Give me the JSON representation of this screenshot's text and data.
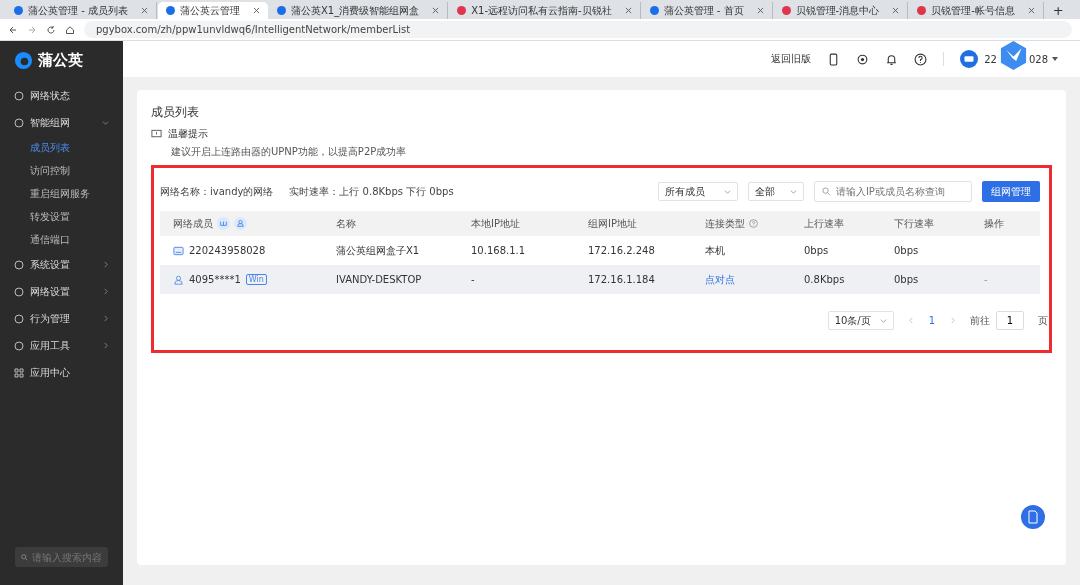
{
  "browser": {
    "tabs": [
      {
        "title": "蒲公英管理 - 成员列表",
        "selected": false,
        "color": "#1a6fe8"
      },
      {
        "title": "蒲公英云管理",
        "selected": true,
        "color": "#1a6fe8"
      },
      {
        "title": "蒲公英X1_消费级智能组网盒",
        "selected": false,
        "color": "#1a6fe8"
      },
      {
        "title": "X1-远程访问私有云指南-贝锐社",
        "selected": false,
        "color": "#e0354b"
      },
      {
        "title": "蒲公英管理 - 首页",
        "selected": false,
        "color": "#1a6fe8"
      },
      {
        "title": "贝锐管理-消息中心",
        "selected": false,
        "color": "#e0354b"
      },
      {
        "title": "贝锐管理-帐号信息",
        "selected": false,
        "color": "#e0354b"
      }
    ],
    "new_tab": "+",
    "url": "pgybox.com/zh/ppw1unvldwq6/IntelligentNetwork/memberList"
  },
  "sidebar": {
    "brand": "蒲公英",
    "items": [
      {
        "label": "网络状态",
        "kind": "leaf"
      },
      {
        "label": "智能组网",
        "kind": "group",
        "expanded": true,
        "children": [
          {
            "label": "成员列表",
            "selected": true
          },
          {
            "label": "访问控制",
            "selected": false
          },
          {
            "label": "重启组网服务",
            "selected": false
          },
          {
            "label": "转发设置",
            "selected": false
          },
          {
            "label": "通信端口",
            "selected": false
          }
        ]
      },
      {
        "label": "系统设置",
        "kind": "group",
        "expanded": false
      },
      {
        "label": "网络设置",
        "kind": "group",
        "expanded": false
      },
      {
        "label": "行为管理",
        "kind": "group",
        "expanded": false
      },
      {
        "label": "应用工具",
        "kind": "group",
        "expanded": false
      },
      {
        "label": "应用中心",
        "kind": "leaf"
      }
    ],
    "search": {
      "placeholder": "请输入搜索内容"
    }
  },
  "header": {
    "old_version": "返回旧版",
    "user_start": "22",
    "user_end": "028"
  },
  "page": {
    "title": "成员列表",
    "tip_title": "温馨提示",
    "tip_text": "建议开启上连路由器的UPNP功能，以提高P2P成功率",
    "network_name": "网络名称：ivandy的网络",
    "rate": "实时速率：上行 0.8Kbps 下行 0bps",
    "filter_members": "所有成员",
    "filter_all": "全部",
    "search_placeholder": "请输入IP或成员名称查询",
    "manage_button": "组网管理",
    "table": {
      "columns": [
        "网络成员",
        "名称",
        "本地IP地址",
        "组网IP地址",
        "连接类型",
        "上行速率",
        "下行速率",
        "操作"
      ],
      "rows": [
        {
          "member": "220243958028",
          "kind": "device",
          "tag": null,
          "name": "蒲公英组网盒子X1",
          "local_ip": "10.168.1.1",
          "net_ip": "172.16.2.248",
          "conn": "本机",
          "conn_link": false,
          "up": "0bps",
          "down": "0bps",
          "action": null,
          "highlighted": false
        },
        {
          "member": "4095****1",
          "kind": "user",
          "tag": "Win",
          "name": "IVANDY-DESKTOP",
          "local_ip": "-",
          "net_ip": "172.16.1.184",
          "conn": "点对点",
          "conn_link": true,
          "up": "0.8Kbps",
          "down": "0bps",
          "action": "-",
          "highlighted": true
        }
      ]
    },
    "pagination": {
      "page_size": "10条/页",
      "pages": [
        {
          "label": "1",
          "selected": true
        }
      ],
      "goto": "前往",
      "goto_value": "1",
      "page_unit": "页"
    }
  }
}
